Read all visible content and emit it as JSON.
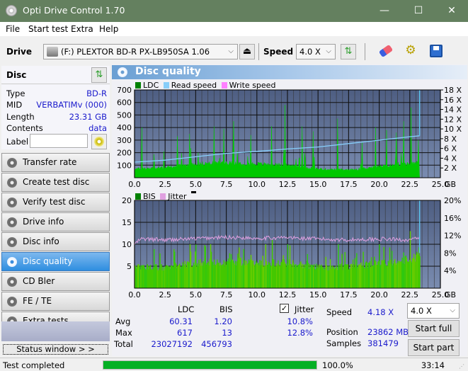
{
  "window": {
    "title": "Opti Drive Control 1.70",
    "minimize": "—",
    "maximize": "☐",
    "close": "✕"
  },
  "menu": [
    "File",
    "Start test",
    "Extra",
    "Help"
  ],
  "toolbar": {
    "drive_label": "Drive",
    "drive_value": "(F:)  PLEXTOR BD-R  PX-LB950SA 1.06",
    "speed_label": "Speed",
    "speed_value": "4.0 X"
  },
  "disc": {
    "header": "Disc",
    "rows": [
      {
        "k": "Type",
        "v": "BD-R"
      },
      {
        "k": "MID",
        "v": "VERBATIMv (000)"
      },
      {
        "k": "Length",
        "v": "23.31 GB"
      },
      {
        "k": "Contents",
        "v": "data"
      }
    ],
    "label_key": "Label",
    "label_value": ""
  },
  "nav": [
    {
      "label": "Transfer rate",
      "active": false
    },
    {
      "label": "Create test disc",
      "active": false
    },
    {
      "label": "Verify test disc",
      "active": false
    },
    {
      "label": "Drive info",
      "active": false
    },
    {
      "label": "Disc info",
      "active": false
    },
    {
      "label": "Disc quality",
      "active": true
    },
    {
      "label": "CD Bler",
      "active": false
    },
    {
      "label": "FE / TE",
      "active": false
    },
    {
      "label": "Extra tests",
      "active": false
    }
  ],
  "status_window_btn": "Status window > >",
  "panel_title": "Disc quality",
  "chart_data": [
    {
      "type": "area",
      "title": "LDC / Read speed",
      "legend": [
        {
          "name": "LDC",
          "color": "#008000"
        },
        {
          "name": "Read speed",
          "color": "#87cefa"
        },
        {
          "name": "Write speed",
          "color": "#ff80ff"
        }
      ],
      "xlabel": "GB",
      "xlim": [
        0,
        25
      ],
      "x_ticks": [
        "0.0",
        "2.5",
        "5.0",
        "7.5",
        "10.0",
        "12.5",
        "15.0",
        "17.5",
        "20.0",
        "22.5",
        "25.0"
      ],
      "ylim_left": [
        0,
        700
      ],
      "y_ticks_left": [
        "100",
        "200",
        "300",
        "400",
        "500",
        "600",
        "700"
      ],
      "ylim_right": [
        0,
        18
      ],
      "y_ticks_right": [
        "2 X",
        "4 X",
        "6 X",
        "8 X",
        "10 X",
        "12 X",
        "14 X",
        "16 X",
        "18 X"
      ],
      "grid": true,
      "ldc_baseline": [
        [
          0,
          70
        ],
        [
          2.5,
          80
        ],
        [
          5,
          110
        ],
        [
          7.5,
          120
        ],
        [
          10,
          110
        ],
        [
          12.5,
          100
        ],
        [
          15,
          70
        ],
        [
          17.5,
          60
        ],
        [
          20,
          90
        ],
        [
          22.5,
          110
        ],
        [
          23.3,
          120
        ]
      ],
      "ldc_spikes": [
        [
          0.6,
          400
        ],
        [
          2.4,
          210
        ],
        [
          3.5,
          330
        ],
        [
          4.5,
          350
        ],
        [
          5.2,
          200
        ],
        [
          6.5,
          410
        ],
        [
          7.3,
          390
        ],
        [
          8.1,
          450
        ],
        [
          9.5,
          340
        ],
        [
          11.2,
          410
        ],
        [
          12.3,
          580
        ],
        [
          13.7,
          410
        ],
        [
          14.6,
          370
        ],
        [
          16.6,
          470
        ],
        [
          18.6,
          280
        ],
        [
          19.7,
          400
        ],
        [
          20.6,
          380
        ],
        [
          21.4,
          360
        ],
        [
          22,
          450
        ],
        [
          22.6,
          560
        ],
        [
          23.2,
          300
        ]
      ],
      "read_speed": [
        [
          0,
          3.2
        ],
        [
          2.5,
          3.6
        ],
        [
          5,
          4.3
        ],
        [
          7.5,
          5.0
        ],
        [
          10,
          5.4
        ],
        [
          12.5,
          5.9
        ],
        [
          15,
          6.3
        ],
        [
          17.5,
          7.0
        ],
        [
          20,
          7.7
        ],
        [
          22.5,
          8.4
        ],
        [
          23.3,
          8.6
        ]
      ],
      "end_marker_x": 23.3
    },
    {
      "type": "area",
      "title": "BIS / Jitter",
      "legend": [
        {
          "name": "BIS",
          "color": "#008000"
        },
        {
          "name": "Jitter",
          "color": "#e0a0e0"
        }
      ],
      "xlabel": "GB",
      "xlim": [
        0,
        25
      ],
      "x_ticks": [
        "0.0",
        "2.5",
        "5.0",
        "7.5",
        "10.0",
        "12.5",
        "15.0",
        "17.5",
        "20.0",
        "22.5",
        "25.0"
      ],
      "ylim_left": [
        0,
        20
      ],
      "y_ticks_left": [
        "5",
        "10",
        "15",
        "20"
      ],
      "ylim_right": [
        0,
        20
      ],
      "y_ticks_right": [
        "4%",
        "8%",
        "12%",
        "16%",
        "20%"
      ],
      "grid": true,
      "bis_typical": [
        [
          0,
          5
        ],
        [
          2.5,
          5
        ],
        [
          5,
          6
        ],
        [
          7.5,
          6
        ],
        [
          10,
          6
        ],
        [
          12.5,
          6
        ],
        [
          15,
          5
        ],
        [
          17.5,
          5
        ],
        [
          20,
          6
        ],
        [
          22.5,
          7
        ],
        [
          23.3,
          8
        ]
      ],
      "bis_spikes": [
        [
          4.5,
          10
        ],
        [
          6.2,
          10
        ],
        [
          11.2,
          11
        ],
        [
          12.5,
          10
        ],
        [
          16.6,
          10
        ],
        [
          20,
          10
        ],
        [
          22.5,
          13
        ]
      ],
      "jitter": [
        [
          0,
          10.0
        ],
        [
          0.5,
          11.2
        ],
        [
          2.5,
          11.0
        ],
        [
          5,
          11.3
        ],
        [
          7.5,
          11.6
        ],
        [
          10,
          11.4
        ],
        [
          12.5,
          11.5
        ],
        [
          15,
          11.2
        ],
        [
          17.5,
          11.0
        ],
        [
          20,
          11.2
        ],
        [
          22.5,
          11.0
        ],
        [
          23.3,
          11.4
        ]
      ],
      "end_marker_x": 23.3
    }
  ],
  "stats": {
    "col_ldc": "LDC",
    "col_bis": "BIS",
    "jitter_label": "Jitter",
    "jitter_checked": true,
    "rows": [
      {
        "label": "Avg",
        "ldc": "60.31",
        "bis": "1.20",
        "jitter": "10.8%"
      },
      {
        "label": "Max",
        "ldc": "617",
        "bis": "13",
        "jitter": "12.8%"
      },
      {
        "label": "Total",
        "ldc": "23027192",
        "bis": "456793",
        "jitter": ""
      }
    ],
    "speed_label": "Speed",
    "speed_value": "4.18 X",
    "position_label": "Position",
    "position_value": "23862 MB",
    "samples_label": "Samples",
    "samples_value": "381479",
    "speed_select": "4.0 X",
    "start_full": "Start full",
    "start_part": "Start part"
  },
  "status": {
    "text": "Test completed",
    "progress": 1.0,
    "progress_text": "100.0%",
    "time": "33:14"
  }
}
